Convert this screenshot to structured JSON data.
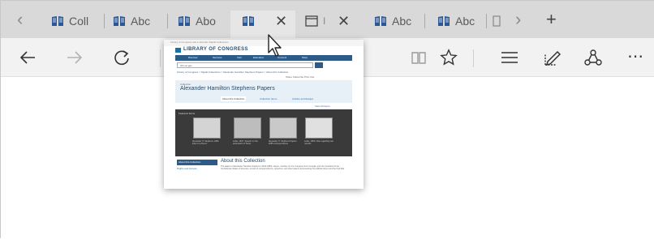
{
  "tabs": [
    {
      "label": "Coll",
      "active": false
    },
    {
      "label": "Abc",
      "active": false
    },
    {
      "label": "Abo",
      "active": false
    },
    {
      "label": "",
      "active": true
    },
    {
      "label": "",
      "active": false
    },
    {
      "label": "Abc",
      "active": false
    },
    {
      "label": "Abc",
      "active": false
    }
  ],
  "icons": {
    "scroll_left": "chevron-left-icon",
    "scroll_right": "chevron-right-icon",
    "new_tab": "plus-icon",
    "close_tab": "close-icon",
    "back": "arrow-left-icon",
    "forward": "arrow-right-icon",
    "refresh": "refresh-icon",
    "reading_view": "book-icon",
    "favorite": "star-icon",
    "hub": "hub-icon",
    "web_note": "pen-note-icon",
    "share": "share-icon",
    "more": "more-icon"
  },
  "colors": {
    "tab_strip": "#d9d9d9",
    "toolbar": "#f2f2f2",
    "favicon_blue": "#2b5797",
    "loc_nav": "#2c5b8a"
  },
  "preview": {
    "top_links": "Library of Congress  Ask a Librarian  Digital Collections",
    "logo_text": "LIBRARY OF CONGRESS",
    "nav": [
      "Discover",
      "Services",
      "Visit",
      "Education",
      "Connect",
      "Shop"
    ],
    "search_scope": "All Loc.gov",
    "breadcrumb": "Library of Congress > Digital Collections > Alexander Hamilton Stephens Papers > About this Collection",
    "share_text": "Share  Subscribe  Print  Cite",
    "collection_label": "Collection",
    "title": "Alexander Hamilton Stephens Papers",
    "tabs": [
      "About this Collection",
      "Collection Items",
      "Articles and Essays"
    ],
    "view_all": "View All Items",
    "featured_label": "Featured Items",
    "featured_captions": [
      "Alexander H. Stephens, 1861 letter to a friend...",
      "Letter, 1847. Speech on the annexation of Texas",
      "Alexander H. Stephens Papers: 1865 correspondence",
      "Letter, 1863. Note regarding war records"
    ],
    "sidebar_title": "About this Collection",
    "sidebar_link": "Rights and Access",
    "about_title": "About this Collection",
    "about_text": "The papers of Alexander Hamilton Stephens (1812-1883), lawyer, member of U.S. Congress from Georgia, and vice president of the Confederate States of America, consist of correspondence, speeches, and other papers documenting his political career and the Civil War."
  }
}
